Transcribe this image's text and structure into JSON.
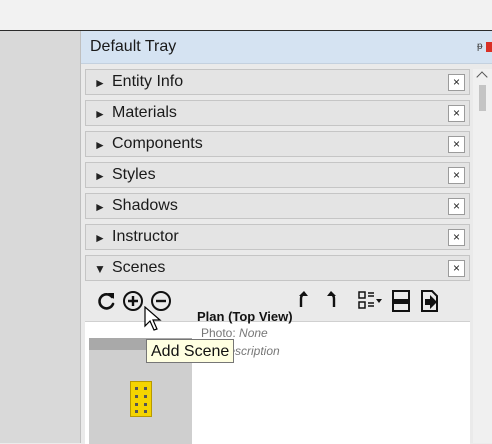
{
  "tray": {
    "title": "Default Tray",
    "sections": [
      {
        "label": "Entity Info",
        "expanded": false
      },
      {
        "label": "Materials",
        "expanded": false
      },
      {
        "label": "Components",
        "expanded": false
      },
      {
        "label": "Styles",
        "expanded": false
      },
      {
        "label": "Shadows",
        "expanded": false
      },
      {
        "label": "Instructor",
        "expanded": false
      },
      {
        "label": "Scenes",
        "expanded": true
      }
    ],
    "collapsed_arrow": "►",
    "expanded_arrow": "▼",
    "close_symbol": "×",
    "pin_symbol": "ᵽ"
  },
  "scenes": {
    "tooltip": "Add Scene",
    "items": [
      {
        "name": "Plan (Top View)",
        "photo_label": "Photo:",
        "photo_value": "None",
        "description": "No Description"
      }
    ]
  },
  "colors": {
    "tray_title_bg": "#d5e3f2",
    "building": "#f4d400",
    "tooltip_bg": "#ffffe1",
    "close_accent": "#d93025"
  },
  "icons": [
    "update-scene-icon",
    "add-scene-icon",
    "remove-scene-icon",
    "move-scene-up-icon",
    "move-scene-down-icon",
    "view-options-icon",
    "scene-details-icon",
    "export-scene-icon"
  ]
}
